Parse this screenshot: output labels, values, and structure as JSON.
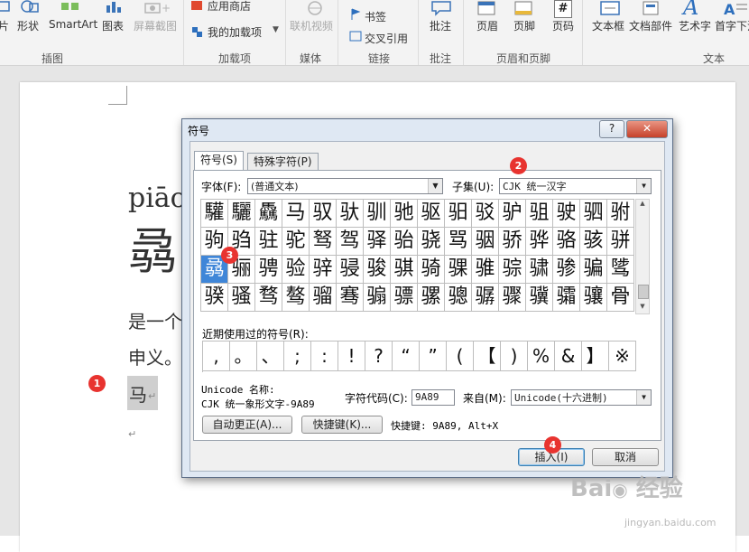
{
  "ribbon": {
    "items": [
      {
        "label": "片",
        "disabled": false
      },
      {
        "label": "形状",
        "disabled": false
      },
      {
        "label": "SmartArt",
        "disabled": false
      },
      {
        "label": "图表",
        "disabled": false
      },
      {
        "label": "屏幕截图",
        "disabled": true
      },
      {
        "label": "应用商店",
        "disabled": false
      },
      {
        "label": "我的加载项",
        "disabled": false
      },
      {
        "label": "联机视频",
        "disabled": true
      },
      {
        "label": "书签",
        "disabled": false
      },
      {
        "label": "交叉引用",
        "disabled": false
      },
      {
        "label": "批注",
        "disabled": false
      },
      {
        "label": "页眉",
        "disabled": false
      },
      {
        "label": "页脚",
        "disabled": false
      },
      {
        "label": "页码",
        "disabled": false
      },
      {
        "label": "文本框",
        "disabled": false
      },
      {
        "label": "文档部件",
        "disabled": false
      },
      {
        "label": "艺术字",
        "disabled": false
      },
      {
        "label": "首字下沉",
        "disabled": false
      }
    ],
    "groups": [
      "插图",
      "加载项",
      "媒体",
      "链接",
      "批注",
      "页眉和页脚",
      "文本"
    ],
    "page_number_glyph": "#",
    "wordart_glyph": "A"
  },
  "document": {
    "pinyin": "piāo",
    "big_char": "骉",
    "line1": "是一个",
    "line2": "申义。",
    "selected_char": "马",
    "return_mark": "↵"
  },
  "dialog": {
    "title": "符号",
    "help": "?",
    "close": "✕",
    "tabs": [
      "符号(S)",
      "特殊字符(P)"
    ],
    "font_label": "字体(F):",
    "font_value": "(普通文本)",
    "subset_label": "子集(U):",
    "subset_value": "CJK 统一汉字",
    "grid": [
      [
        "驩",
        "驪",
        "驫",
        "马",
        "驭",
        "驮",
        "驯",
        "驰",
        "驱",
        "驲",
        "驳",
        "驴",
        "驵",
        "驶",
        "驷",
        "驸"
      ],
      [
        "驹",
        "驺",
        "驻",
        "驼",
        "驽",
        "驾",
        "驿",
        "骀",
        "骁",
        "骂",
        "骃",
        "骄",
        "骅",
        "骆",
        "骇",
        "骈"
      ],
      [
        "骉",
        "骊",
        "骋",
        "验",
        "骍",
        "骎",
        "骏",
        "骐",
        "骑",
        "骒",
        "骓",
        "骔",
        "骕",
        "骖",
        "骗",
        "骘"
      ],
      [
        "骙",
        "骚",
        "骛",
        "骜",
        "骝",
        "骞",
        "骟",
        "骠",
        "骡",
        "骢",
        "骣",
        "骤",
        "骥",
        "骦",
        "骧",
        "骨"
      ]
    ],
    "selected_cell": "骉",
    "recent_label": "近期使用过的符号(R):",
    "recent": [
      ",",
      "。",
      "、",
      ";",
      ":",
      "!",
      "?",
      "“",
      "”",
      "(",
      "【",
      ")",
      "%",
      "&",
      "】",
      "※"
    ],
    "unicode_label": "Unicode 名称:",
    "unicode_name": "CJK 统一象形文字-9A89",
    "charcode_label": "字符代码(C):",
    "charcode_value": "9A89",
    "from_label": "来自(M):",
    "from_value": "Unicode(十六进制)",
    "autocorrect_btn": "自动更正(A)...",
    "shortcut_btn": "快捷键(K)...",
    "shortcut_text": "快捷键: 9A89, Alt+X",
    "insert_btn": "插入(I)",
    "cancel_btn": "取消"
  },
  "badges": [
    "1",
    "2",
    "3",
    "4"
  ],
  "colors": {
    "badge": "#e8332f",
    "selection": "#3f86d8",
    "close": "#c6412a"
  }
}
